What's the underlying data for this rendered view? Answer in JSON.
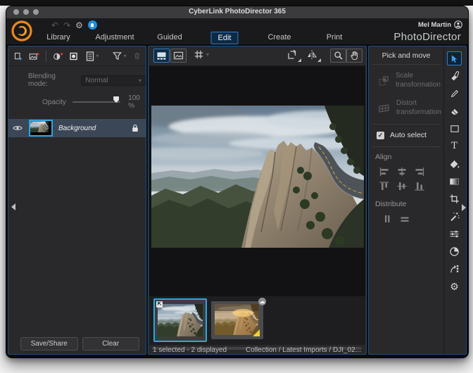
{
  "window": {
    "title": "CyberLink PhotoDirector 365"
  },
  "header": {
    "user": "Mel Martin",
    "brand": "PhotoDirector",
    "active_tab": "Edit",
    "tabs": [
      {
        "label": "Library"
      },
      {
        "label": "Adjustment"
      },
      {
        "label": "Guided"
      },
      {
        "label": "Edit"
      },
      {
        "label": "Create"
      },
      {
        "label": "Print"
      }
    ]
  },
  "icons": {
    "undo": "↶",
    "redo": "↷",
    "gear": "⚙",
    "caret": "▾",
    "cloud": "☁",
    "check": "✓",
    "edited": "⇱"
  },
  "layers": {
    "blending_label": "Blending mode:",
    "blending_value": "Normal",
    "opacity_label": "Opacity",
    "opacity_value": "100 %",
    "layer_name": "Background",
    "save_button": "Save/Share",
    "clear_button": "Clear"
  },
  "filmstrip": {
    "status_selected": "1 selected - 2 displayed",
    "status_path": "Collection / Latest Imports / DJI_02..."
  },
  "transform": {
    "title": "Pick and move",
    "scale": "Scale transformation",
    "distort": "Distort transformation",
    "auto_select": "Auto select",
    "auto_select_checked": true,
    "align": "Align",
    "distribute": "Distribute"
  },
  "tools": {
    "text_glyph": "T",
    "names": [
      "pick-and-move",
      "removal",
      "pen",
      "eraser",
      "shape",
      "text",
      "fill",
      "gradient",
      "crop",
      "magic-wand",
      "adjustment",
      "vignette",
      "export",
      "settings"
    ]
  },
  "colors": {
    "accent_blue": "#2a7fd0",
    "selection_cyan": "#29a8e1",
    "panel_border_blue": "#1d4e7e",
    "badge_blue": "#1e8fe0",
    "logo_orange": "#e8891d",
    "warning_yellow": "#f2d233"
  }
}
